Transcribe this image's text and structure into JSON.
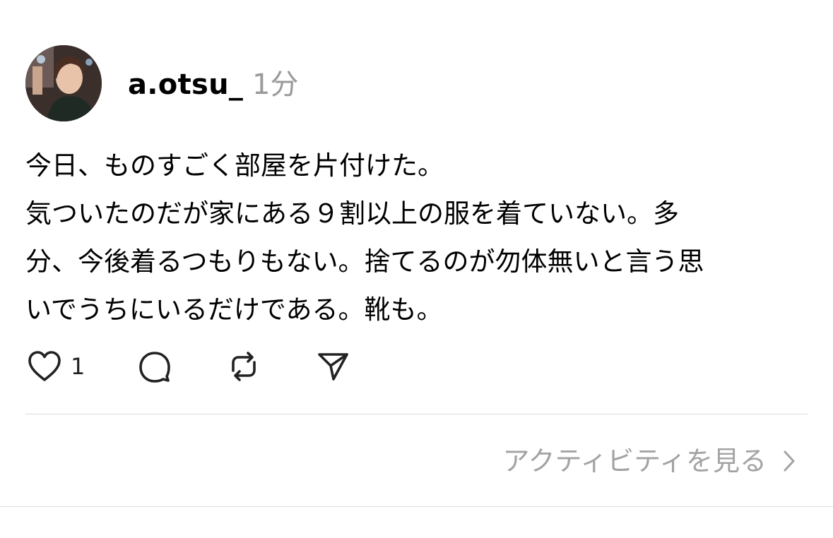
{
  "post": {
    "username": "a.otsu_",
    "time": "1分",
    "body_lines": [
      "今日、ものすごく部屋を片付けた。",
      "気ついたのだが家にある９割以上の服を着ていない。多",
      "分、今後着るつもりもない。捨てるのが勿体無いと言う思",
      "いでうちにいるだけである。靴も。"
    ]
  },
  "actions": {
    "like_count": "1",
    "icons": [
      "heart-icon",
      "comment-icon",
      "repost-icon",
      "share-icon"
    ]
  },
  "activity": {
    "label": "アクティビティを見る",
    "icon": "chevron-right-icon"
  },
  "colors": {
    "text": "#000000",
    "muted": "#9a9a9a",
    "divider": "#dcdcdc"
  }
}
